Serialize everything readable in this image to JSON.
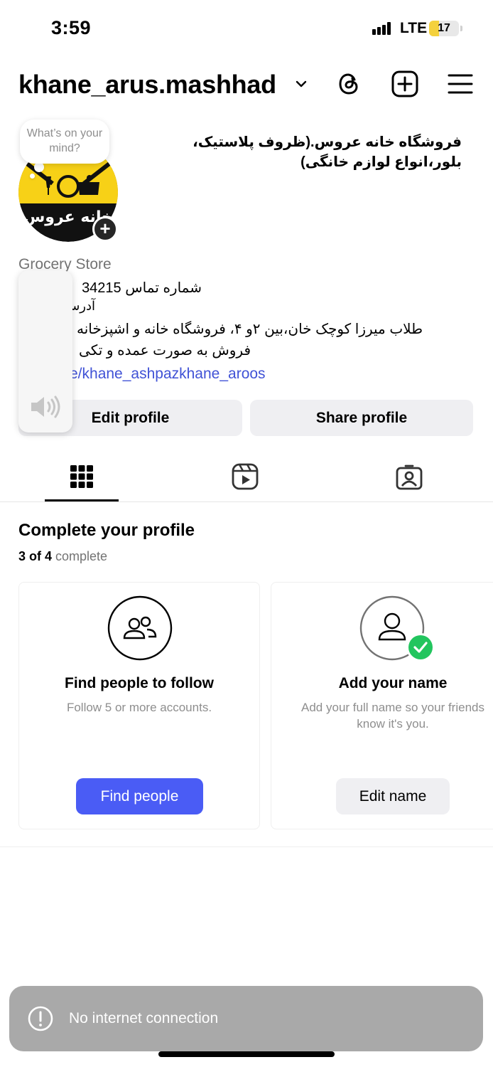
{
  "status_bar": {
    "time": "3:59",
    "network": "LTE",
    "battery": "17",
    "battery_level_percent": 17
  },
  "header": {
    "username": "khane_arus.mashhad",
    "icons": [
      "chevron-down-icon",
      "threads-icon",
      "create-icon",
      "menu-icon"
    ]
  },
  "profile": {
    "note_prompt": "What’s on your mind?",
    "display_name": "فروشگاه خانه عروس.(ظروف پلاستیک، بلور،انواع لوازم خانگی)",
    "avatar_text": "خانه عروس",
    "category": "Grocery Store",
    "bio_phone": "شماره تماس 34215",
    "bio_address_label": "آدرس",
    "bio_address": "طلاب میرزا کوچک خان،بین ۲و ۴، فروشگاه خانه و اشپزخانه",
    "bio_sales": "فروش به صورت عمده و تکی",
    "link": "e/khane_ashpazkhane_aroos"
  },
  "actions": {
    "edit_profile": "Edit profile",
    "share_profile": "Share profile"
  },
  "tabs": [
    {
      "icon": "grid-icon",
      "active": true
    },
    {
      "icon": "reels-icon",
      "active": false
    },
    {
      "icon": "tagged-icon",
      "active": false
    }
  ],
  "complete_profile": {
    "title": "Complete your profile",
    "done": "3 of 4",
    "suffix": "complete",
    "cards": [
      {
        "icon": "people-icon",
        "title": "Find people to follow",
        "subtitle": "Follow 5 or more accounts.",
        "button": "Find people",
        "completed": false
      },
      {
        "icon": "person-icon",
        "title": "Add your name",
        "subtitle": "Add your full name so your friends know it's you.",
        "button": "Edit name",
        "completed": true
      }
    ]
  },
  "toast": {
    "message": "No internet connection",
    "icon": "alert-icon"
  },
  "colors": {
    "accent_blue": "#4a5cf5",
    "link_blue": "#4052d6",
    "success_green": "#22c55e",
    "avatar_yellow": "#f7d117"
  }
}
